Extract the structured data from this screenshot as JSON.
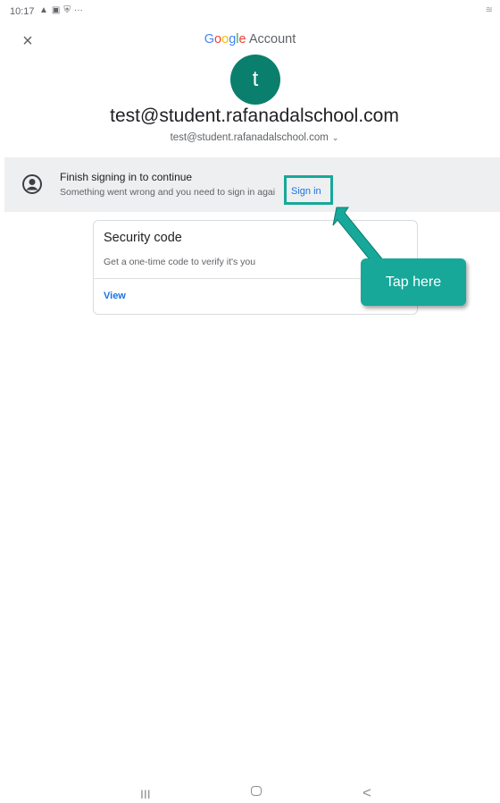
{
  "status_bar": {
    "time": "10:17",
    "icons": [
      "warning-icon",
      "image-icon",
      "shield-icon",
      "more-icon"
    ],
    "more": "···"
  },
  "header": {
    "close_label": "×",
    "brand_letters": [
      "G",
      "o",
      "o",
      "g",
      "l",
      "e"
    ],
    "brand_suffix": "Account"
  },
  "profile": {
    "avatar_initial": "t",
    "email_title": "test@student.rafanadalschool.com",
    "email_sub": "test@student.rafanadalschool.com",
    "chevron": "⌵"
  },
  "banner": {
    "title": "Finish signing in to continue",
    "text": "Something went wrong and you need to sign in agai",
    "link": "Sign in"
  },
  "card": {
    "title": "Security code",
    "text": "Get a one-time code to verify it's you",
    "link": "View"
  },
  "callout": {
    "text": "Tap here"
  },
  "nav": {
    "recents": "III",
    "back": "<"
  },
  "colors": {
    "accent": "#17a89a",
    "avatar": "#0b7f6e",
    "link": "#1a73e8"
  }
}
